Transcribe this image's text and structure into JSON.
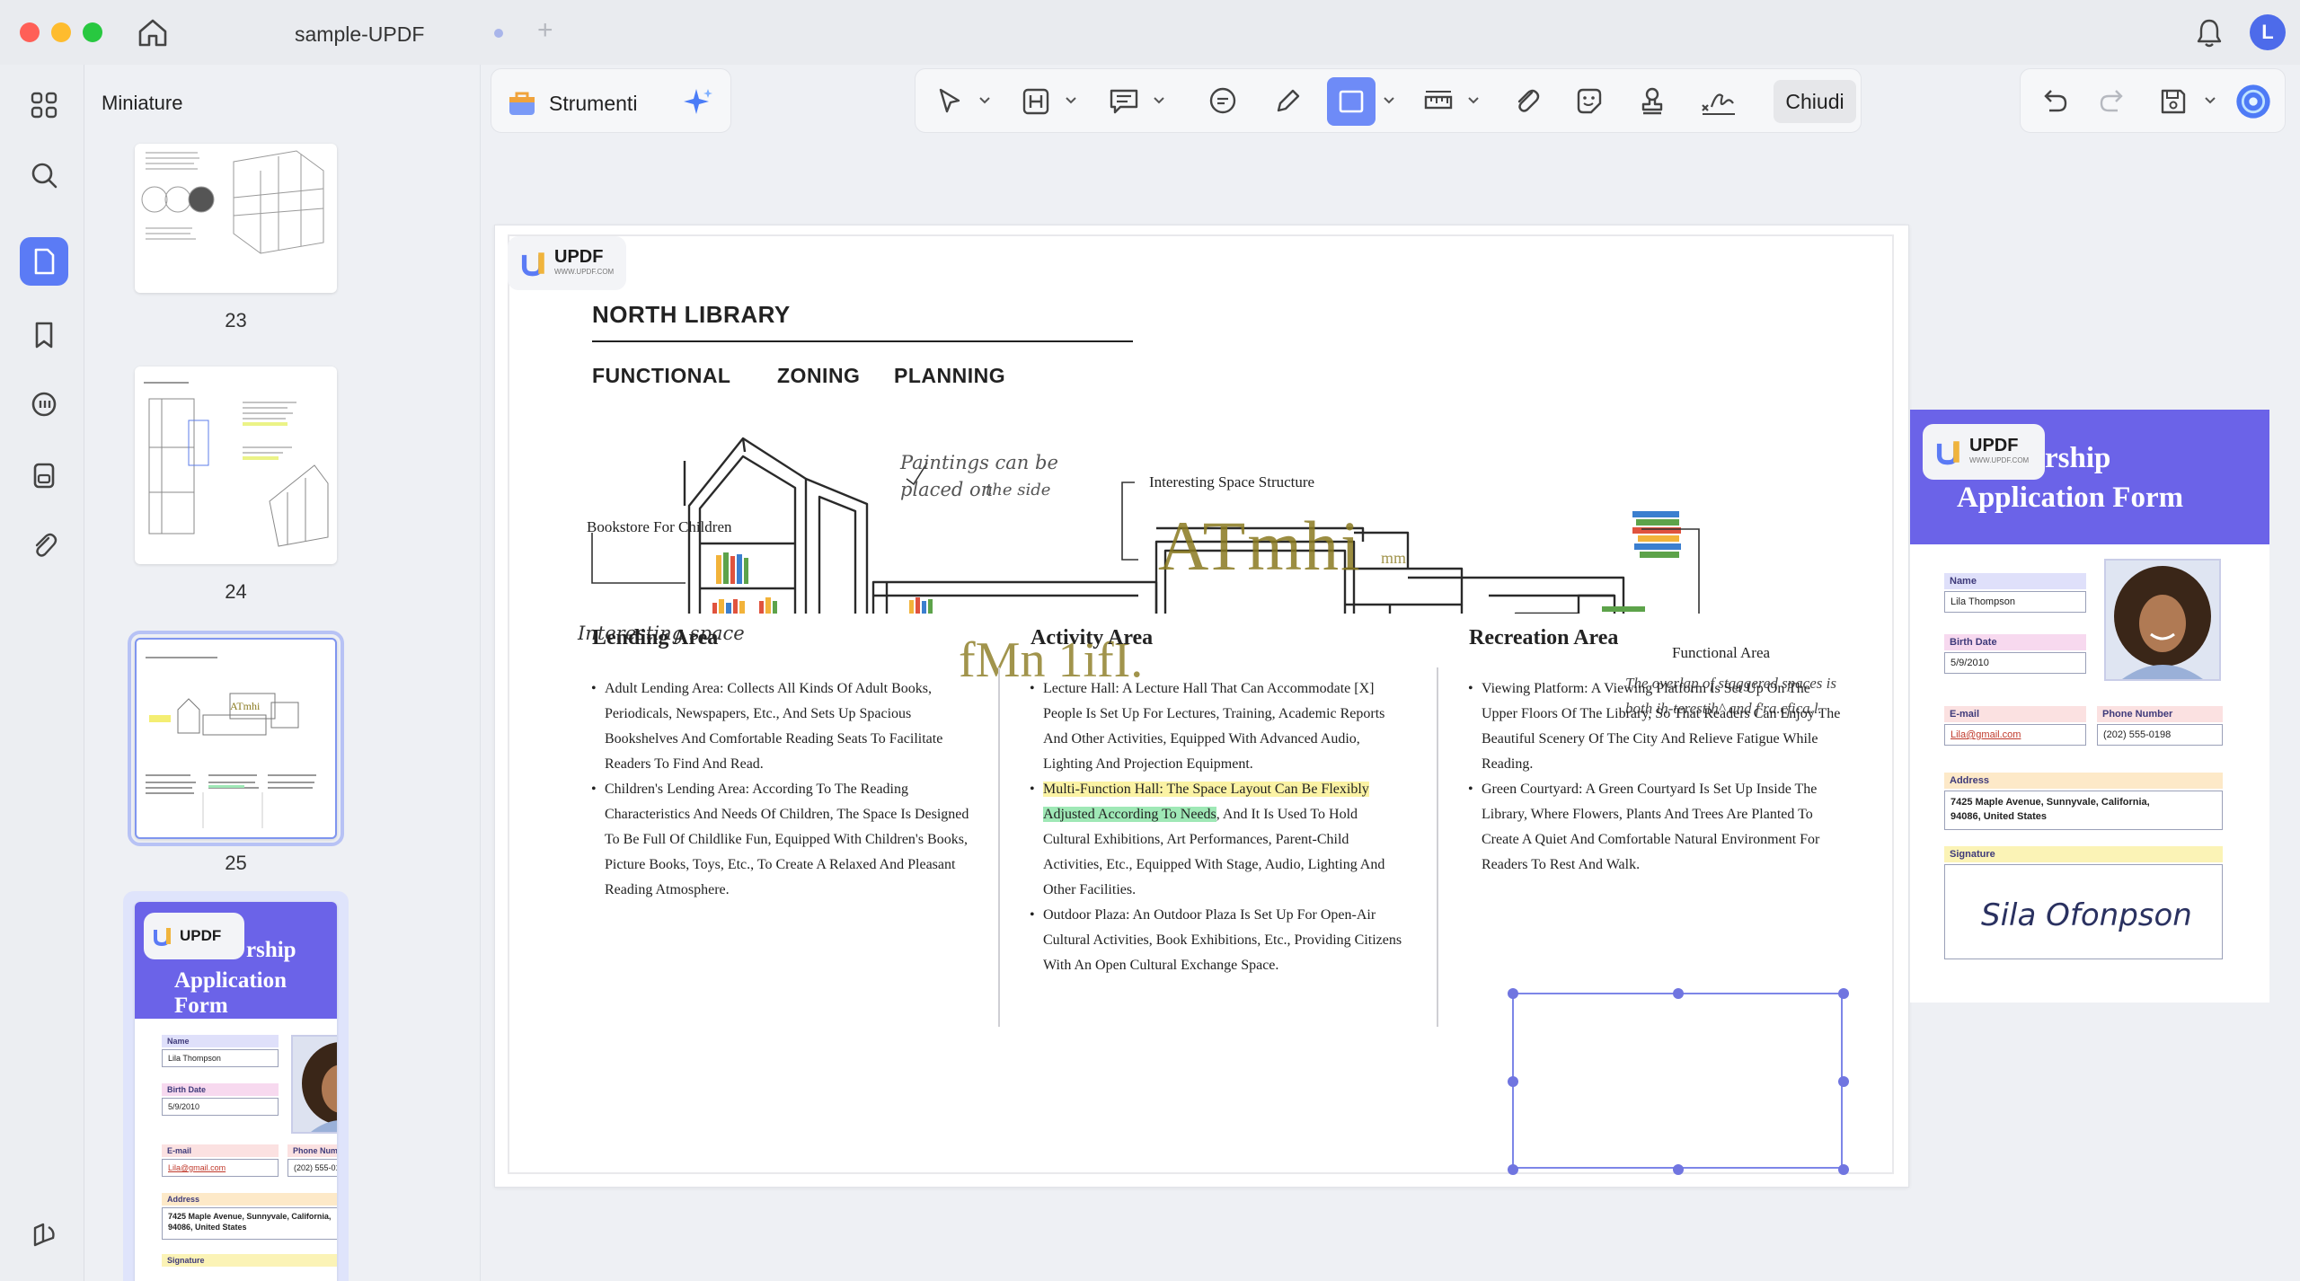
{
  "window": {
    "tab_title": "sample-UPDF",
    "new_tab_symbol": "+",
    "avatar_initial": "L"
  },
  "sidebar": {
    "panel_title": "Miniature",
    "thumbnails": [
      {
        "page": "23"
      },
      {
        "page": "24"
      },
      {
        "page": "25"
      }
    ]
  },
  "toolbar": {
    "tools_label": "Strumenti",
    "close_label": "Chiudi"
  },
  "brand": {
    "logo_text": "UPDF",
    "logo_sub": "WWW.UPDF.COM"
  },
  "document": {
    "title": "NORTH LIBRARY",
    "subtitle_words": [
      "FUNCTIONAL",
      "ZONING",
      "PLANNING"
    ],
    "drawing_labels": {
      "bookstore": "Bookstore For Children",
      "paintings_line1": "Paintings can be",
      "paintings_line2": "placed on",
      "paintings_line3": "the side",
      "interesting_structure": "Interesting Space Structure",
      "interesting_space": "Interesting space",
      "functional_area": "Functional Area",
      "overlap_line1": "The overlap of staggered spaces is",
      "overlap_line2": "both ih-terestih^ and f'ra.cfica.l.",
      "ocr_big": "ATmhi",
      "ocr_small": "mm",
      "ocr_mid": "fMn 1ifI."
    },
    "columns": [
      {
        "title": "Lending Area",
        "items": [
          "Adult Lending Area: Collects All Kinds Of Adult Books, Periodicals, Newspapers, Etc., And Sets Up Spacious Bookshelves And Comfortable Reading Seats To Facilitate Readers To Find And Read.",
          "Children's Lending Area: According To The Reading Characteristics And Needs Of Children, The Space Is Designed To Be Full Of Childlike Fun, Equipped With Children's Books, Picture Books, Toys, Etc., To Create A Relaxed And Pleasant Reading Atmosphere."
        ]
      },
      {
        "title": "Activity Area",
        "items": [
          "Lecture Hall: A Lecture Hall That Can Accommodate [X] People Is Set Up For Lectures, Training, Academic Reports And Other Activities, Equipped With Advanced Audio, Lighting And Projection Equipment.",
          "Outdoor Plaza: An Outdoor Plaza Is Set Up For Open-Air Cultural Activities, Book Exhibitions, Etc., Providing Citizens With An Open Cultural Exchange Space."
        ],
        "highlight_yellow": "Multi-Function Hall: The Space Layout Can Be Flexibly",
        "highlight_green": "Adjusted According To Needs",
        "highlight_rest": ", And It Is Used To Hold Cultural Exhibitions, Art Performances, Parent-Child Activities, Etc., Equipped With Stage, Audio, Lighting And Other Facilities."
      },
      {
        "title": "Recreation Area",
        "items": [
          "Viewing Platform: A Viewing Platform Is Set Up On The Upper Floors Of The Library, So That Readers Can Enjoy The Beautiful Scenery Of The City And Relieve Fatigue While Reading.",
          "Green Courtyard: A Green Courtyard Is Set Up Inside The Library, Where Flowers, Plants And Trees Are Planted To Create A Quiet And Comfortable Natural Environment For Readers To Rest And Walk."
        ]
      }
    ]
  },
  "form": {
    "title_line1": "rship",
    "title_line2": "Application Form",
    "name_label": "Name",
    "name_value": "Lila Thompson",
    "birth_label": "Birth Date",
    "birth_value": "5/9/2010",
    "email_label": "E-mail",
    "email_value": "Lila@gmail.com",
    "phone_label": "Phone Number",
    "phone_value": "(202) 555-0198",
    "address_label": "Address",
    "address_line1": "7425 Maple Avenue, Sunnyvale, California,",
    "address_line2": "94086, United States",
    "signature_label": "Signature",
    "signature_value": "Sila Ofonpson"
  },
  "colors": {
    "accent": "#5b7bf5",
    "form_header": "#6b63e8",
    "highlight_yellow": "#fbf3a4",
    "highlight_green": "#9fe8b6"
  }
}
